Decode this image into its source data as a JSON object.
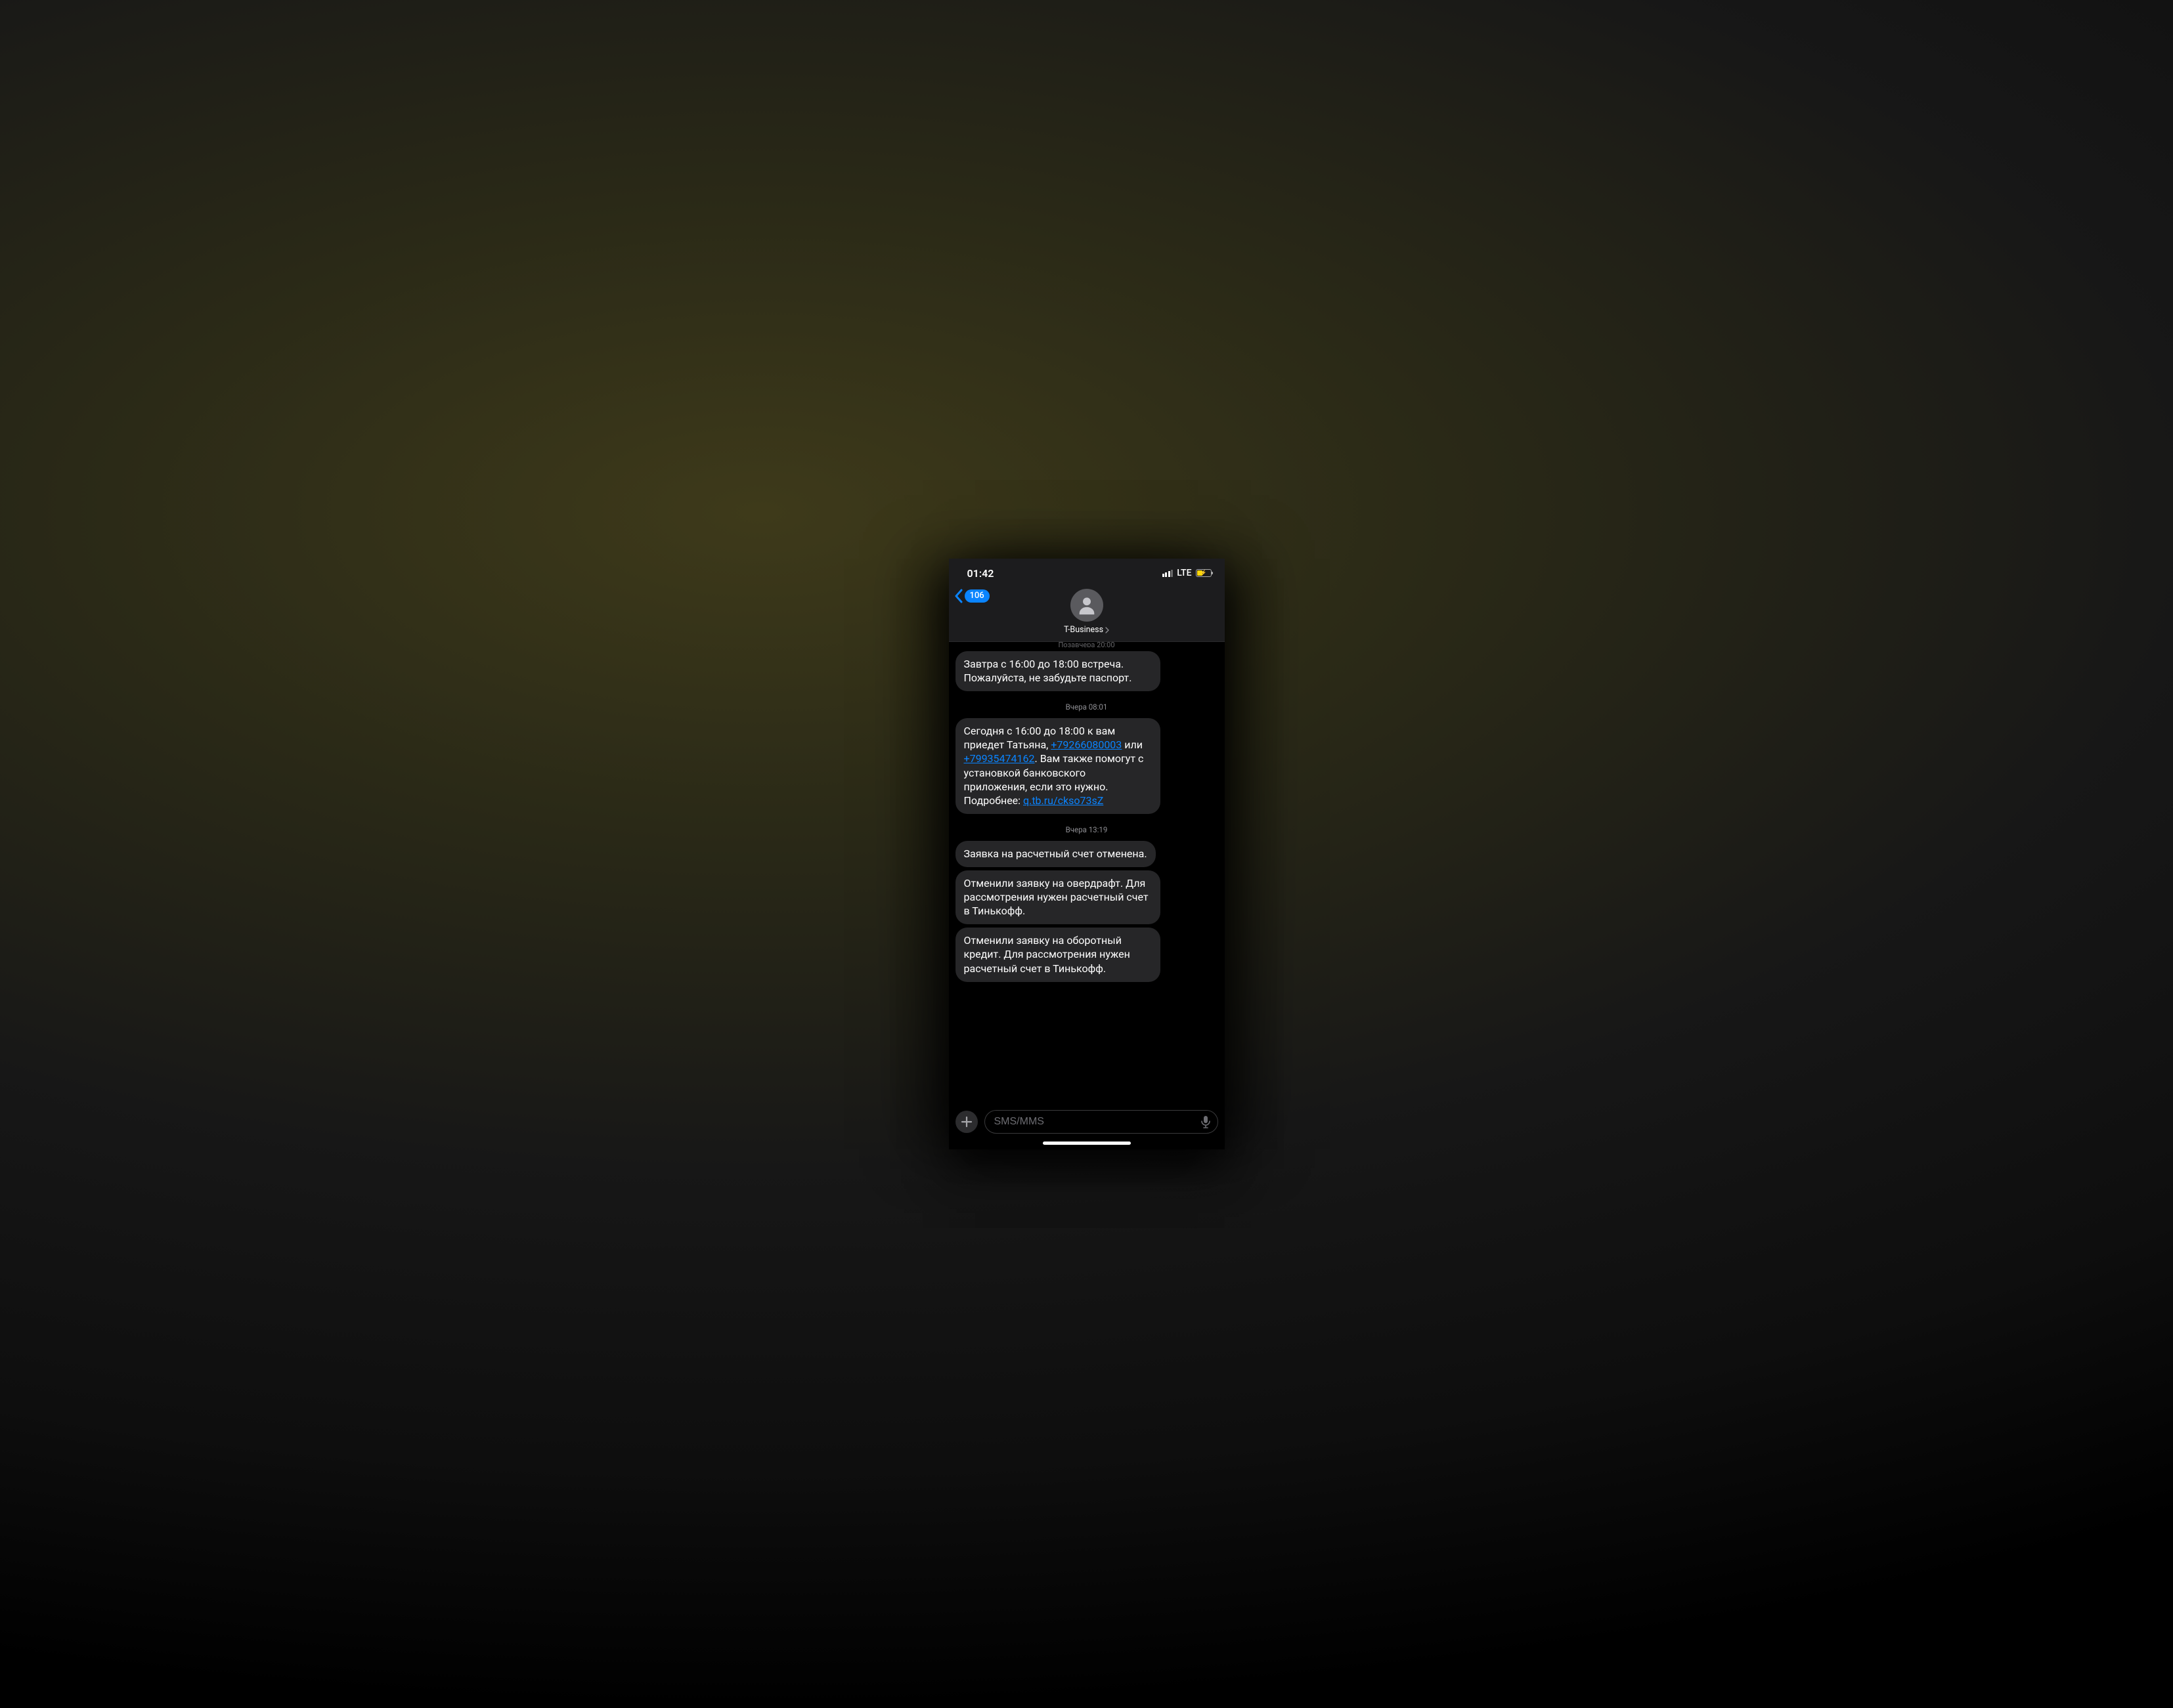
{
  "status": {
    "time": "01:42",
    "network": "LTE"
  },
  "nav": {
    "back_count": "106",
    "contact_name": "T-Business"
  },
  "cutoff_timestamp": "Позавчера 20:00",
  "messages": [
    {
      "type": "bubble",
      "text": "Завтра с 16:00 до 18:00 встреча. Пожалуйста, не забудьте паспорт."
    },
    {
      "type": "timestamp",
      "text": "Вчера 08:01"
    },
    {
      "type": "bubble_rich",
      "parts": [
        {
          "t": "text",
          "v": "Сегодня с 16:00 до 18:00 к вам приедет Татьяна, "
        },
        {
          "t": "link",
          "v": "+79266080003"
        },
        {
          "t": "text",
          "v": " или "
        },
        {
          "t": "link",
          "v": "+79935474162"
        },
        {
          "t": "text",
          "v": ". Вам также помогут с установкой банковского приложения, если это нужно. Подробнее: "
        },
        {
          "t": "link",
          "v": "q.tb.ru/ckso73sZ"
        }
      ]
    },
    {
      "type": "timestamp",
      "text": "Вчера 13:19"
    },
    {
      "type": "bubble",
      "text": "Заявка на расчетный счет отменена."
    },
    {
      "type": "bubble",
      "text": "Отменили заявку на овердрафт. Для рассмотрения нужен расчетный счет в Тинькофф."
    },
    {
      "type": "bubble",
      "text": "Отменили заявку на оборотный кредит. Для рассмотрения нужен расчетный счет в Тинькофф."
    }
  ],
  "compose": {
    "placeholder": "SMS/MMS"
  }
}
